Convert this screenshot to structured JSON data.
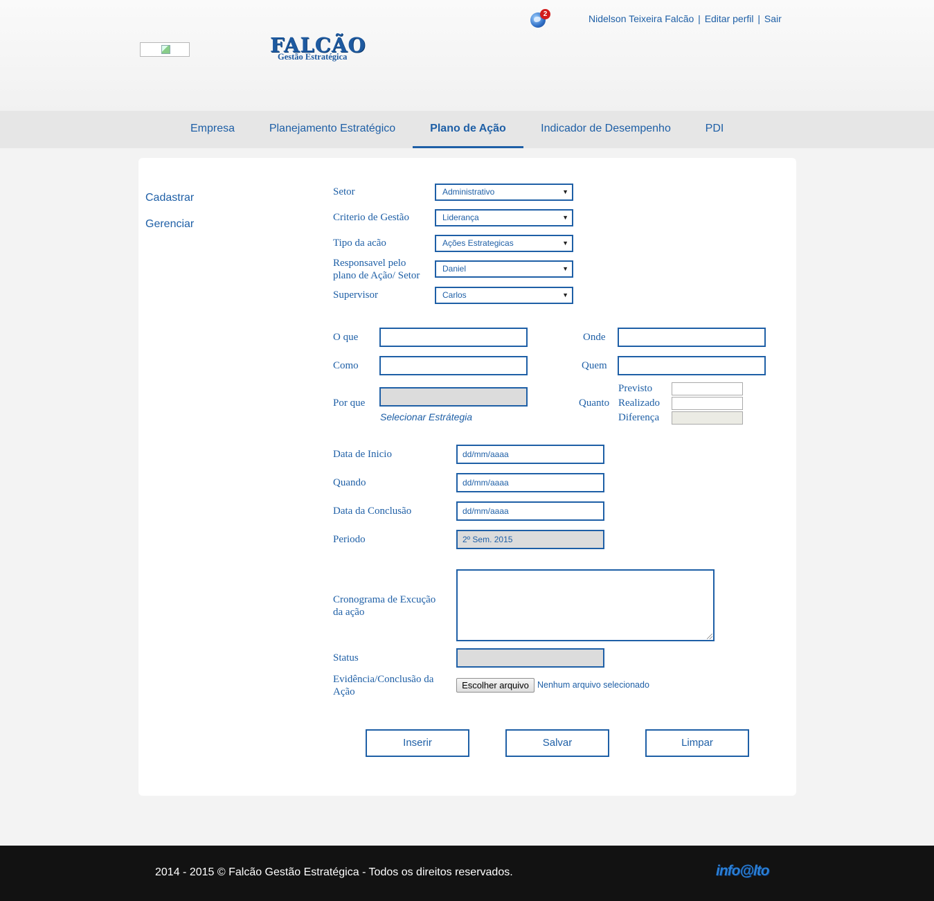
{
  "header": {
    "logo_title": "FALCÃO",
    "logo_subtitle": "Gestão Estratégica",
    "notification_count": "2",
    "user_name": "Nidelson Teixeira Falcão",
    "edit_profile": "Editar perfil",
    "logout": "Sair",
    "separator": "|"
  },
  "nav": {
    "items": [
      {
        "label": "Empresa"
      },
      {
        "label": "Planejamento Estratégico"
      },
      {
        "label": "Plano de Ação"
      },
      {
        "label": "Indicador de Desempenho"
      },
      {
        "label": "PDI"
      }
    ],
    "active": "Plano de Ação"
  },
  "sidebar": {
    "items": [
      {
        "label": "Cadastrar"
      },
      {
        "label": "Gerenciar"
      }
    ]
  },
  "form": {
    "setor": {
      "label": "Setor",
      "value": "Administrativo"
    },
    "criterio": {
      "label": "Criterio de Gestão",
      "value": "Liderança"
    },
    "tipo": {
      "label": "Tipo da acão",
      "value": "Ações Estrategicas"
    },
    "responsavel": {
      "label_line1": "Responsavel pelo",
      "label_line2": "plano de Ação/ Setor",
      "value": "Daniel"
    },
    "supervisor": {
      "label": "Supervisor",
      "value": "Carlos"
    },
    "o_que": {
      "label": "O que",
      "value": ""
    },
    "onde": {
      "label": "Onde",
      "value": ""
    },
    "como": {
      "label": "Como",
      "value": ""
    },
    "quem": {
      "label": "Quem",
      "value": ""
    },
    "por_que": {
      "label": "Por que",
      "value": "",
      "link": "Selecionar Estrátegia"
    },
    "quanto": {
      "label": "Quanto",
      "previsto": "Previsto",
      "realizado": "Realizado",
      "diferenca": "Diferença"
    },
    "data_inicio": {
      "label": "Data de Inicio",
      "value": "dd/mm/aaaa"
    },
    "quando": {
      "label": "Quando",
      "value": "dd/mm/aaaa"
    },
    "data_conclusao": {
      "label": "Data da Conclusão",
      "value": "dd/mm/aaaa"
    },
    "periodo": {
      "label": "Periodo",
      "value": "2º Sem. 2015"
    },
    "cronograma": {
      "label_line1": "Cronograma de Excução",
      "label_line2": "da ação",
      "value": ""
    },
    "status": {
      "label": "Status",
      "value": ""
    },
    "evidencia": {
      "label_line1": "Evidência/Conclusão da",
      "label_line2": "Ação",
      "button": "Escolher arquivo",
      "no_file": "Nenhum arquivo selecionado"
    }
  },
  "actions": {
    "insert": "Inserir",
    "save": "Salvar",
    "clear": "Limpar"
  },
  "footer": {
    "copyright": "2014 - 2015 © Falcão Gestão Estratégica - Todos os direitos reservados.",
    "logo": "info@lto"
  },
  "colors": {
    "accent": "#1e5fa6",
    "footer_bg": "#121212",
    "nav_bg": "#e6e6e6",
    "badge": "#d21c1c"
  }
}
